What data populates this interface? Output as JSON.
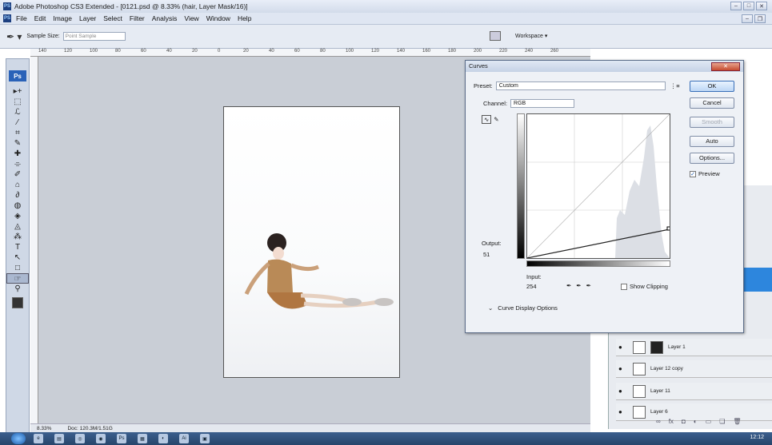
{
  "window": {
    "title": "Adobe Photoshop CS3 Extended - [0121.psd @ 8.33% (hair, Layer Mask/16)]",
    "icon": "PS"
  },
  "menu": {
    "items": [
      "File",
      "Edit",
      "Image",
      "Layer",
      "Select",
      "Filter",
      "Analysis",
      "View",
      "Window",
      "Help"
    ]
  },
  "options": {
    "sample_size_label": "Sample Size:",
    "sample_size_value": "Point Sample",
    "workspace_label": "Workspace ▾"
  },
  "ruler": {
    "ticks": [
      "140",
      "120",
      "100",
      "80",
      "60",
      "40",
      "20",
      "0",
      "20",
      "40",
      "60",
      "80",
      "100",
      "120",
      "140",
      "160",
      "180",
      "200",
      "220",
      "240",
      "260"
    ]
  },
  "toolbox": {
    "logo": "Ps",
    "tools": [
      "▸+",
      "⬚",
      "ℒ",
      "⁄",
      "⌗",
      "✎",
      "✚",
      "⌯",
      "✐",
      "⌂",
      "∂",
      "◍",
      "◈",
      "◬",
      "⁂",
      "T",
      "↖",
      "□",
      "☞",
      "⚲"
    ]
  },
  "status": {
    "zoom": "8.33%",
    "doc": "Doc: 120.3M/1.51G"
  },
  "curves": {
    "title": "Curves",
    "close_label": "✕",
    "preset_label": "Preset:",
    "preset_value": "Custom",
    "channel_label": "Channel:",
    "channel_value": "RGB",
    "output_label": "Output:",
    "output_value": "51",
    "input_label": "Input:",
    "input_value": "254",
    "show_clipping_label": "Show Clipping",
    "curve_display_label": "Curve Display Options",
    "buttons": {
      "ok": "OK",
      "cancel": "Cancel",
      "smooth": "Smooth",
      "auto": "Auto",
      "options": "Options...",
      "preview": "Preview"
    }
  },
  "layers": {
    "rows": [
      {
        "name": "Layer 1"
      },
      {
        "name": "Layer 12 copy"
      },
      {
        "name": "Layer 11"
      },
      {
        "name": "Layer 6"
      }
    ]
  },
  "taskbar": {
    "clock": "12:12",
    "apps": [
      "e",
      "▤",
      "◎",
      "◉",
      "Ps",
      "▦",
      "◐",
      "Ai",
      "▣"
    ]
  },
  "colors": {
    "accent": "#2d86dd",
    "toolbar_bg": "#cfd8e6",
    "workspace_bg": "#c9ced6"
  }
}
